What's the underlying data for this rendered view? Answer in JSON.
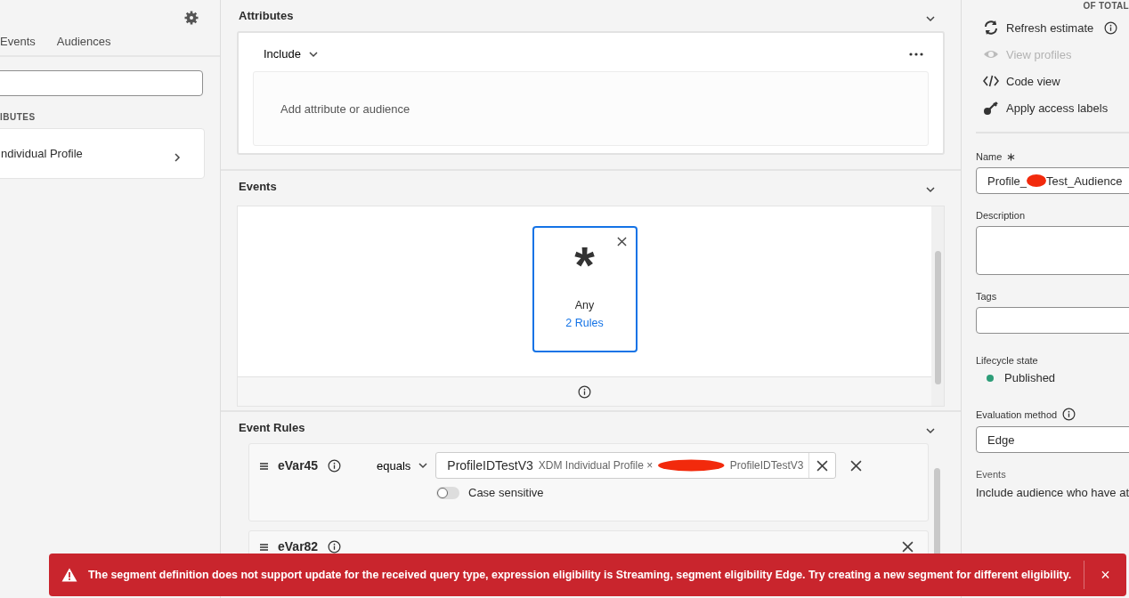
{
  "left_panel": {
    "tabs": [
      {
        "label": "Events",
        "selected": false
      },
      {
        "label": "Audiences",
        "selected": false
      }
    ],
    "section_heading": "IBUTES",
    "items": [
      {
        "label": "ndividual Profile"
      }
    ]
  },
  "attributes": {
    "title": "Attributes",
    "expanded": true,
    "mode": "Include",
    "drop_hint": "Add attribute or audience"
  },
  "events": {
    "title": "Events",
    "expanded": true,
    "card": {
      "symbol": "*",
      "label": "Any",
      "link": "2 Rules",
      "selected": true
    }
  },
  "event_rules": {
    "title": "Event Rules",
    "expanded": true,
    "rules": [
      {
        "name": "eVar45",
        "operator": "equals",
        "value": "ProfileIDTestV3",
        "detail": "XDM Individual Profile ×",
        "detail_end": "ProfileIDTestV3",
        "case_sensitive": false,
        "toggle_label": "Case sensitive"
      },
      {
        "name": "eVar82"
      }
    ]
  },
  "right_panel": {
    "total_label": "OF TOTAL",
    "actions": [
      {
        "kind": "refresh",
        "label": "Refresh estimate",
        "disabled": false,
        "info": true
      },
      {
        "kind": "view",
        "label": "View profiles",
        "disabled": true,
        "info": false
      },
      {
        "kind": "code",
        "label": "Code view",
        "disabled": false,
        "info": false
      },
      {
        "kind": "key",
        "label": "Apply access labels",
        "disabled": false,
        "info": false
      }
    ],
    "name": {
      "label": "Name",
      "required": true,
      "value_start": "Profile_",
      "value_end": "Test_Audience"
    },
    "description": {
      "label": "Description"
    },
    "tags": {
      "label": "Tags"
    },
    "lifecycle": {
      "label": "Lifecycle state",
      "value": "Published",
      "color": "#2d9d78"
    },
    "evaluation": {
      "label": "Evaluation method",
      "value": "Edge"
    },
    "events_label": "Events",
    "events_text": "Include audience who have at"
  },
  "toast": {
    "kind": "error",
    "message": "The segment definition does not support update for the received query type, expression eligibility is Streaming, segment eligibility Edge. Try creating a new segment for different eligibility.",
    "close": "×"
  }
}
